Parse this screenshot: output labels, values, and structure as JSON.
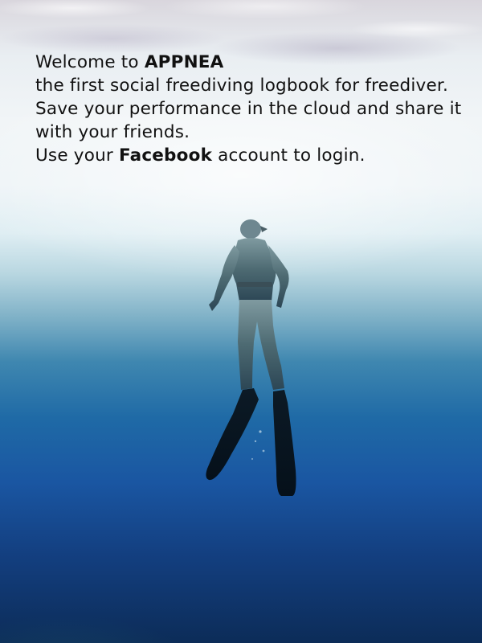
{
  "welcome": {
    "line1_prefix": "Welcome to ",
    "app_name": "APPNEA",
    "line2": "the first social freediving logbook for freediver.",
    "line3": "Save your performance in the cloud and share it with your friends.",
    "line4_prefix": "Use your ",
    "facebook": "Facebook",
    "line4_suffix": " account to login."
  },
  "colors": {
    "text": "#111111",
    "surface": "#e9eef2",
    "deep": "#133f80"
  },
  "background": {
    "icon": "freediver-underwater-illustration"
  }
}
